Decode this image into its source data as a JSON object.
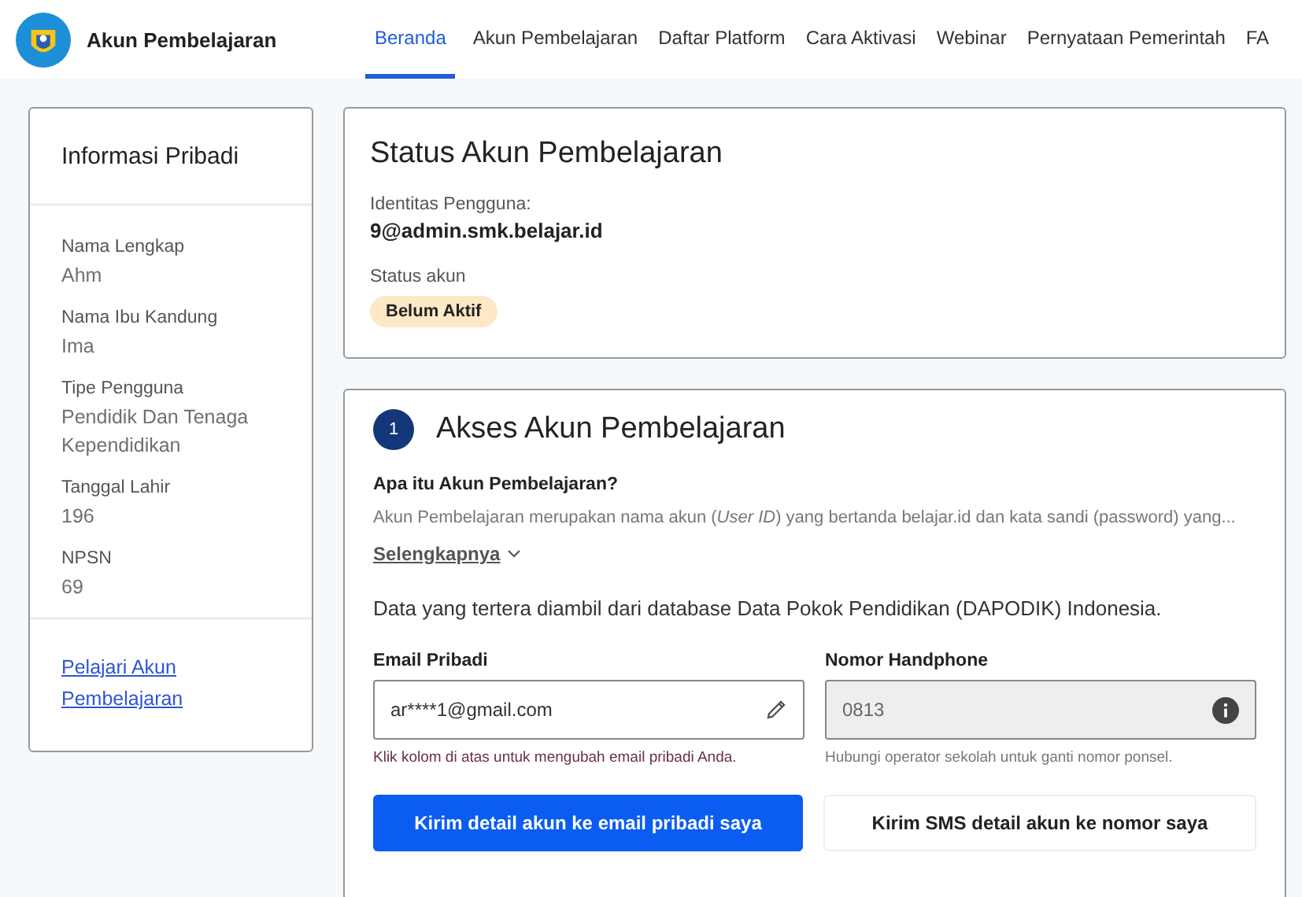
{
  "header": {
    "brand": "Akun Pembelajaran",
    "nav": [
      {
        "label": "Beranda",
        "selected": true
      },
      {
        "label": "Akun Pembelajaran",
        "selected": false
      },
      {
        "label": "Daftar Platform",
        "selected": false
      },
      {
        "label": "Cara Aktivasi",
        "selected": false
      },
      {
        "label": "Webinar",
        "selected": false
      },
      {
        "label": "Pernyataan Pemerintah",
        "selected": false
      },
      {
        "label": "FA",
        "selected": false
      }
    ]
  },
  "personal_info": {
    "title": "Informasi Pribadi",
    "fields": [
      {
        "label": "Nama Lengkap",
        "value": "Ahm"
      },
      {
        "label": "Nama Ibu Kandung",
        "value": "Ima"
      },
      {
        "label": "Tipe Pengguna",
        "value": "Pendidik Dan Tenaga Kependidikan"
      },
      {
        "label": "Tanggal Lahir",
        "value": "196"
      },
      {
        "label": "NPSN",
        "value": "69"
      }
    ],
    "link": "Pelajari Akun Pembelajaran"
  },
  "status": {
    "title": "Status Akun Pembelajaran",
    "identity_label": "Identitas Pengguna:",
    "identity_value": "9@admin.smk.belajar.id",
    "status_label": "Status akun",
    "badge": "Belum Aktif"
  },
  "access": {
    "step": "1",
    "title": "Akses Akun Pembelajaran",
    "question": "Apa itu Akun Pembelajaran?",
    "description": "Akun Pembelajaran merupakan nama akun (*User ID*) yang bertanda belajar.id dan kata sandi (password) yang...",
    "more": "Selengkapnya",
    "source_note": "Data yang tertera diambil dari database Data Pokok Pendidikan (DAPODIK) Indonesia.",
    "fields": [
      {
        "label": "Email Pribadi",
        "value": "ar****1@gmail.com",
        "hint": "Klik kolom di atas untuk mengubah email pribadi Anda.",
        "disabled": false
      },
      {
        "label": "Nomor Handphone",
        "value": "0813",
        "hint": "Hubungi operator sekolah untuk ganti nomor ponsel.",
        "disabled": true
      }
    ],
    "buttons": [
      {
        "label": "Kirim detail akun ke email pribadi saya",
        "kind": "primary"
      },
      {
        "label": "Kirim SMS detail akun ke nomor saya",
        "kind": "secondary"
      }
    ]
  }
}
